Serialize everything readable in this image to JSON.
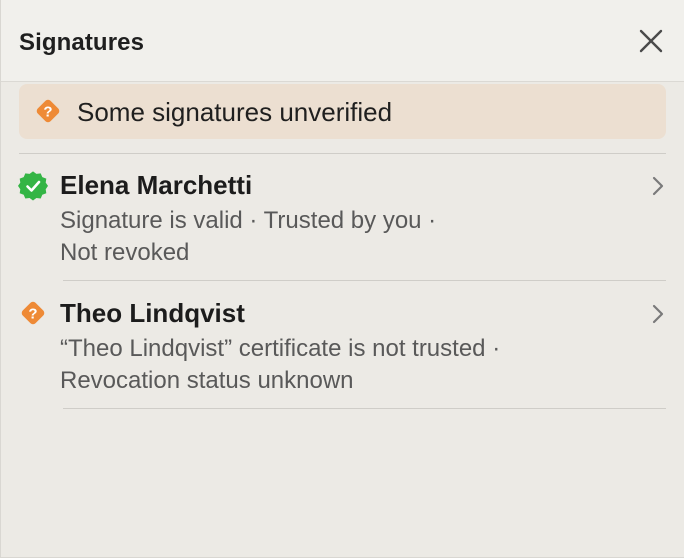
{
  "panel": {
    "title": "Signatures"
  },
  "banner": {
    "text": "Some signatures unverified",
    "icon": "warning-question-icon",
    "color": "#ee8a36"
  },
  "signatures": [
    {
      "name": "Elena Marchetti",
      "status": "valid",
      "icon": "verified-check-icon",
      "icon_color": "#34b545",
      "detail_line1": "Signature is valid · Trusted by you ·",
      "detail_line2": "Not revoked"
    },
    {
      "name": "Theo Lindqvist",
      "status": "unverified",
      "icon": "warning-question-icon",
      "icon_color": "#ee8a36",
      "detail_line1": "“Theo Lindqvist” certificate is not trusted ·",
      "detail_line2": "Revocation status unknown"
    }
  ]
}
